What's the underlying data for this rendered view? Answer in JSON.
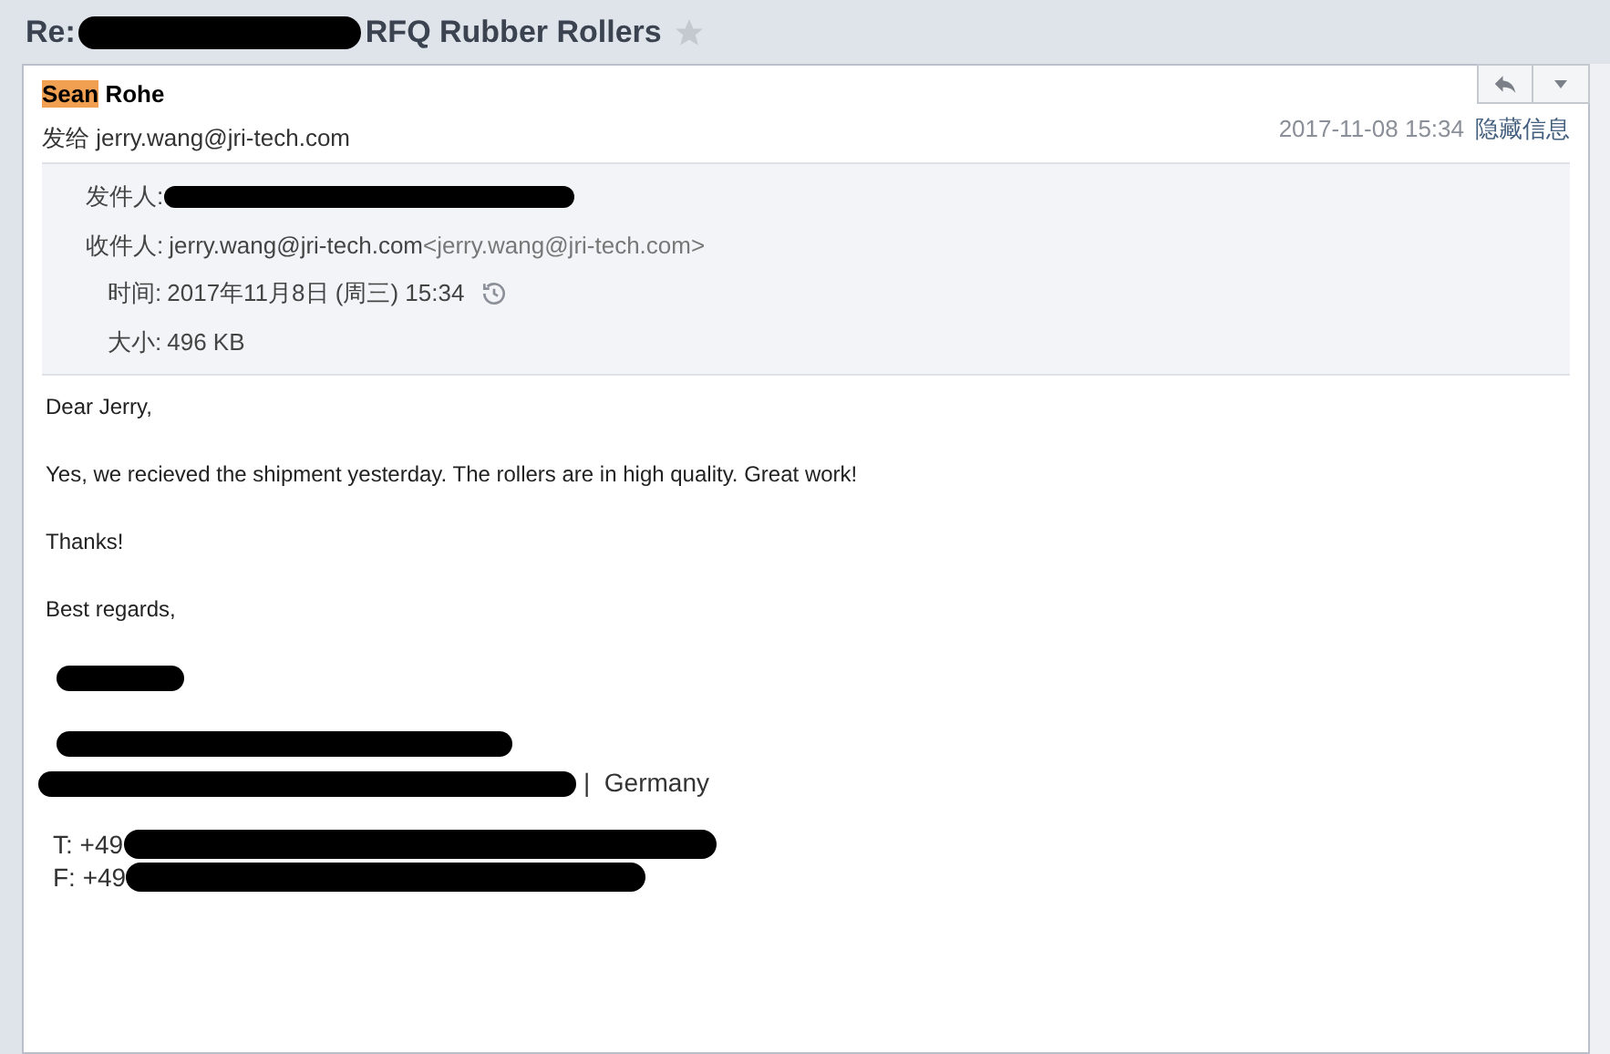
{
  "title": {
    "prefix": "Re:",
    "subject": "RFQ Rubber Rollers",
    "starred": false
  },
  "header": {
    "sender_highlight": "Sean",
    "sender_rest": "Rohe",
    "to_label": "发给",
    "to": "jerry.wang@jri-tech.com",
    "date": "2017-11-08 15:34",
    "toggle_link": "隐藏信息"
  },
  "details": [
    {
      "kind": "redacted",
      "label": "发件人:"
    },
    {
      "kind": "address",
      "label": "收件人:",
      "value": "jerry.wang@jri-tech.com",
      "extra": "<jerry.wang@jri-tech.com>"
    },
    {
      "kind": "time",
      "label": "时间:",
      "value": "2017年11月8日 (周三) 15:34"
    },
    {
      "kind": "plain",
      "label": "大小:",
      "value": "496 KB"
    }
  ],
  "body": [
    "Dear Jerry,",
    "Yes, we recieved the shipment yesterday. The rollers are in high quality. Great work!",
    "Thanks!",
    "Best regards,"
  ],
  "signature": [
    {
      "kind": "redacted"
    },
    {
      "kind": "gap"
    },
    {
      "kind": "redacted"
    },
    {
      "kind": "suffix",
      "text": "|  Germany"
    },
    {
      "kind": "gap"
    },
    {
      "kind": "prefix",
      "text": "T: +49"
    },
    {
      "kind": "prefix",
      "text": "F: +49"
    }
  ]
}
